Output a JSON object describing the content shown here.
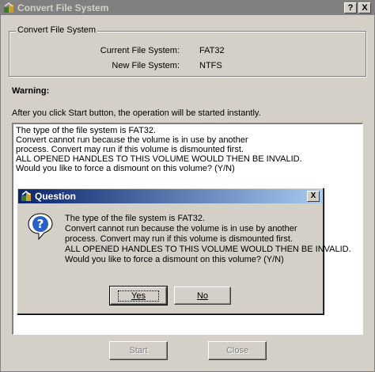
{
  "window": {
    "title": "Convert File System",
    "help_button": "?",
    "close_button": "X"
  },
  "group": {
    "label": "Convert File System",
    "current_label": "Current File System:",
    "current_value": "FAT32",
    "new_label": "New File System:",
    "new_value": "NTFS"
  },
  "warning": {
    "label": "Warning:",
    "info": "After you click Start button, the operation will be started instantly."
  },
  "output": {
    "lines": [
      "The type of the file system is FAT32.",
      "Convert cannot run because the volume is in use by another",
      "process.  Convert may run if this volume is dismounted first.",
      "ALL OPENED HANDLES TO THIS VOLUME WOULD THEN BE INVALID.",
      "Would you like to force a dismount on this volume? (Y/N)"
    ]
  },
  "dialog": {
    "title": "Question",
    "close_button": "X",
    "icon": "question-icon",
    "lines": [
      "The type of the file system is FAT32.",
      "Convert cannot run because the volume is in use by another",
      "process. Convert may run if this volume is dismounted first.",
      "ALL OPENED HANDLES TO THIS VOLUME WOULD THEN BE INVALID.",
      "Would you like to force a dismount on this volume? (Y/N)"
    ],
    "yes_label": "Yes",
    "no_label": "No"
  },
  "buttons": {
    "start_label": "Start",
    "close_label": "Close"
  },
  "colors": {
    "face": "#d4d0c8",
    "inactive_titlebar": "#808080",
    "active_titlebar": "#0a246a"
  }
}
